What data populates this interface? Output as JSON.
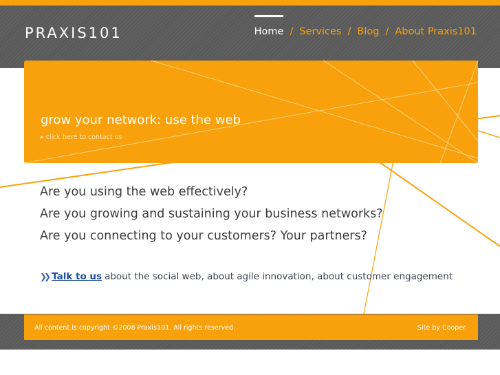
{
  "site": {
    "logo_text": "PRAXIS101"
  },
  "nav": {
    "items": [
      {
        "label": "Home",
        "active": true
      },
      {
        "label": "Services",
        "active": false
      },
      {
        "label": "Blog",
        "active": false
      },
      {
        "label": "About Praxis101",
        "active": false
      }
    ],
    "separator": "/"
  },
  "banner": {
    "title": "grow your network: use the web",
    "link_label": "click here to contact us"
  },
  "main": {
    "questions": [
      "Are you using the web effectively?",
      "Are you growing and sustaining your business networks?",
      "Are you connecting to your customers? Your partners?"
    ],
    "cta_link": "Talk to us",
    "cta_text": "about the social web, about agile innovation, about customer engagement"
  },
  "footer": {
    "copyright": "All content is copyright ©2008 Praxis101. All rights reserved.",
    "credit": "Site by Cooper"
  },
  "colors": {
    "accent": "#f9a10d",
    "header_bg": "#5a5a5a",
    "link": "#1f4f99"
  }
}
